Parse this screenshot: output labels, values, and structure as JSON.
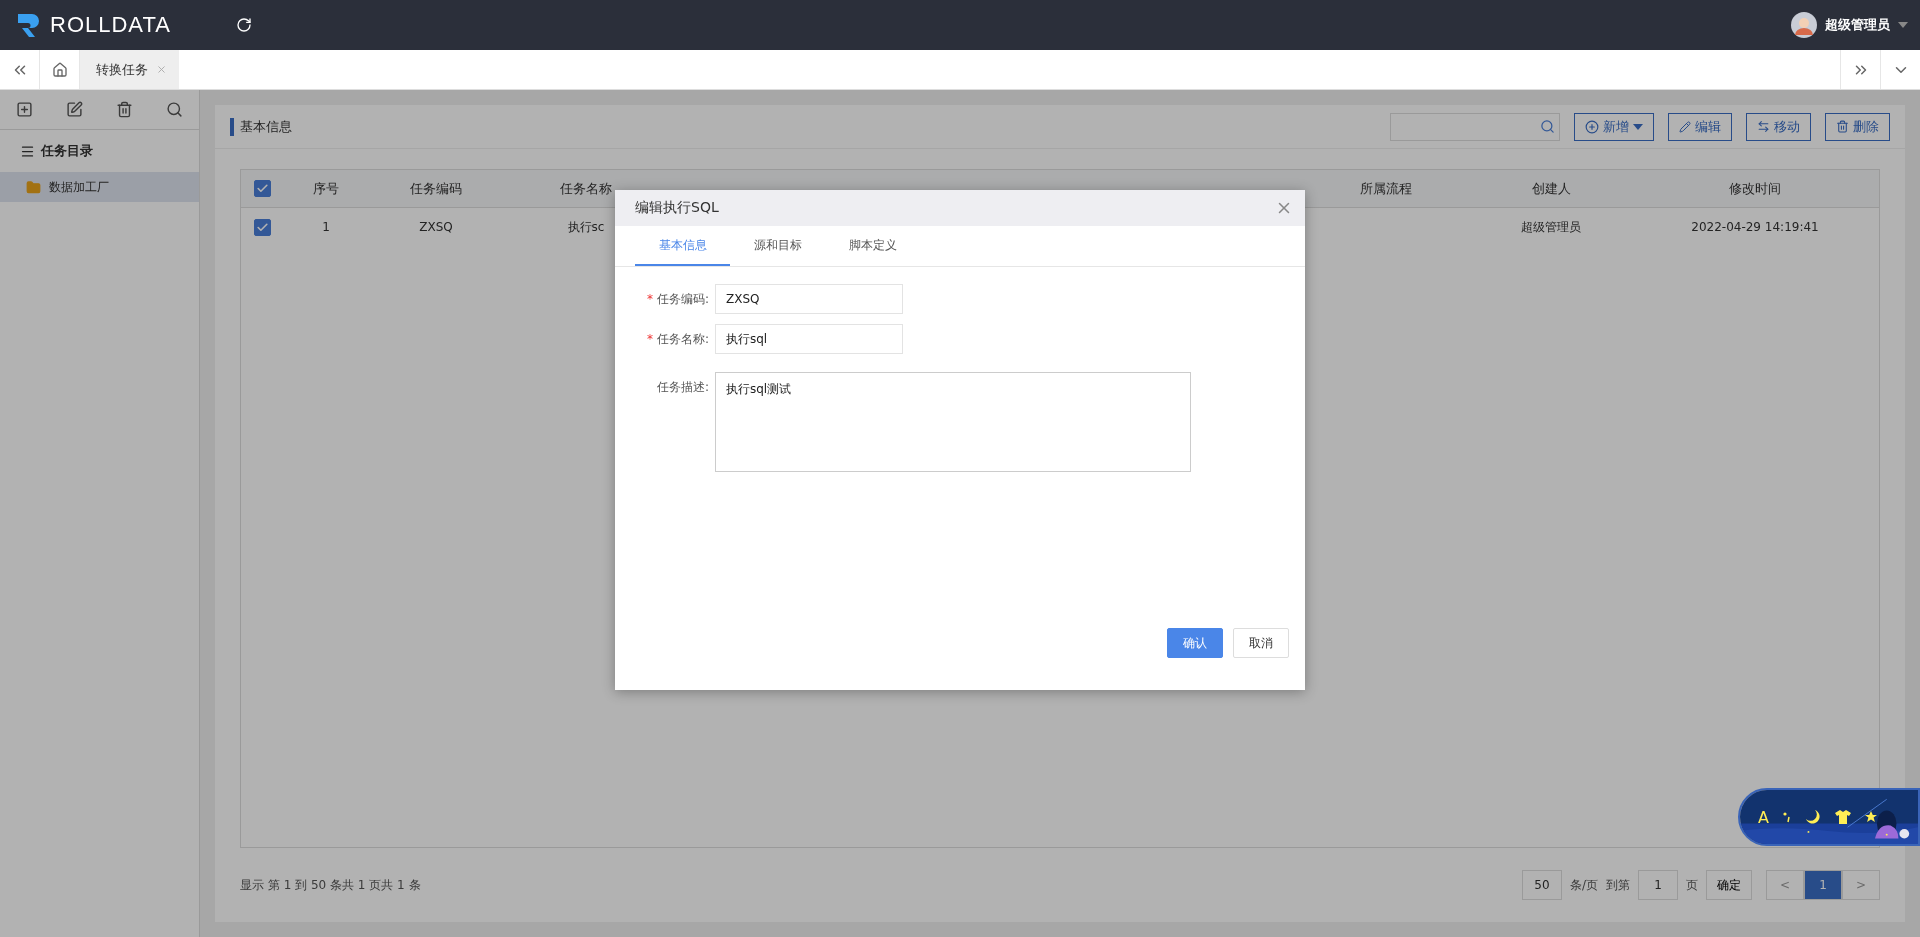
{
  "header": {
    "logo": "ROLLDATA",
    "user": "超级管理员"
  },
  "tabs": [
    {
      "label": "转换任务",
      "selected": true
    }
  ],
  "sidebar": {
    "title": "任务目录",
    "items": [
      {
        "label": "数据加工厂",
        "selected": true
      }
    ]
  },
  "panel": {
    "title": "基本信息"
  },
  "toolbar": [
    {
      "label": "新增",
      "kind": "add"
    },
    {
      "label": "编辑",
      "kind": "edit"
    },
    {
      "label": "移动",
      "kind": "move"
    },
    {
      "label": "删除",
      "kind": "delete"
    }
  ],
  "table": {
    "all_checked": true,
    "columns": [
      "序号",
      "任务编码",
      "任务名称",
      "所属流程",
      "创建人",
      "修改时间"
    ],
    "rows": [
      {
        "checked": true,
        "seq": "1",
        "code": "ZXSQ",
        "name": "执行sc",
        "creator": "超级管理员",
        "modified": "2022-04-29 14:19:41"
      }
    ]
  },
  "footer": {
    "summary": "显示 第 1 到 50 条共 1 页共 1 条",
    "page_size": "50",
    "per_page": "条/页",
    "goto": "到第",
    "page_input": "1",
    "page_unit": "页",
    "confirm": "确定",
    "prev": "<",
    "pages": [
      {
        "label": "1",
        "selected": true
      }
    ],
    "next": ">"
  },
  "dialog": {
    "title": "编辑执行SQL",
    "required_mark": "*",
    "tabs": [
      {
        "label": "基本信息",
        "selected": true
      },
      {
        "label": "源和目标",
        "selected": false
      },
      {
        "label": "脚本定义",
        "selected": false
      }
    ],
    "fields": [
      {
        "kind": "input",
        "label": "任务编码:",
        "value": "ZXSQ",
        "required": true
      },
      {
        "kind": "input",
        "label": "任务名称:",
        "value": "执行sql",
        "required": true
      },
      {
        "kind": "textarea",
        "label": "任务描述:",
        "value": "执行sql测试",
        "required": false
      }
    ],
    "buttons": [
      {
        "label": "确认",
        "kind": "primary"
      },
      {
        "label": "取消",
        "kind": "default"
      }
    ]
  },
  "widget": {
    "letter": "A"
  }
}
